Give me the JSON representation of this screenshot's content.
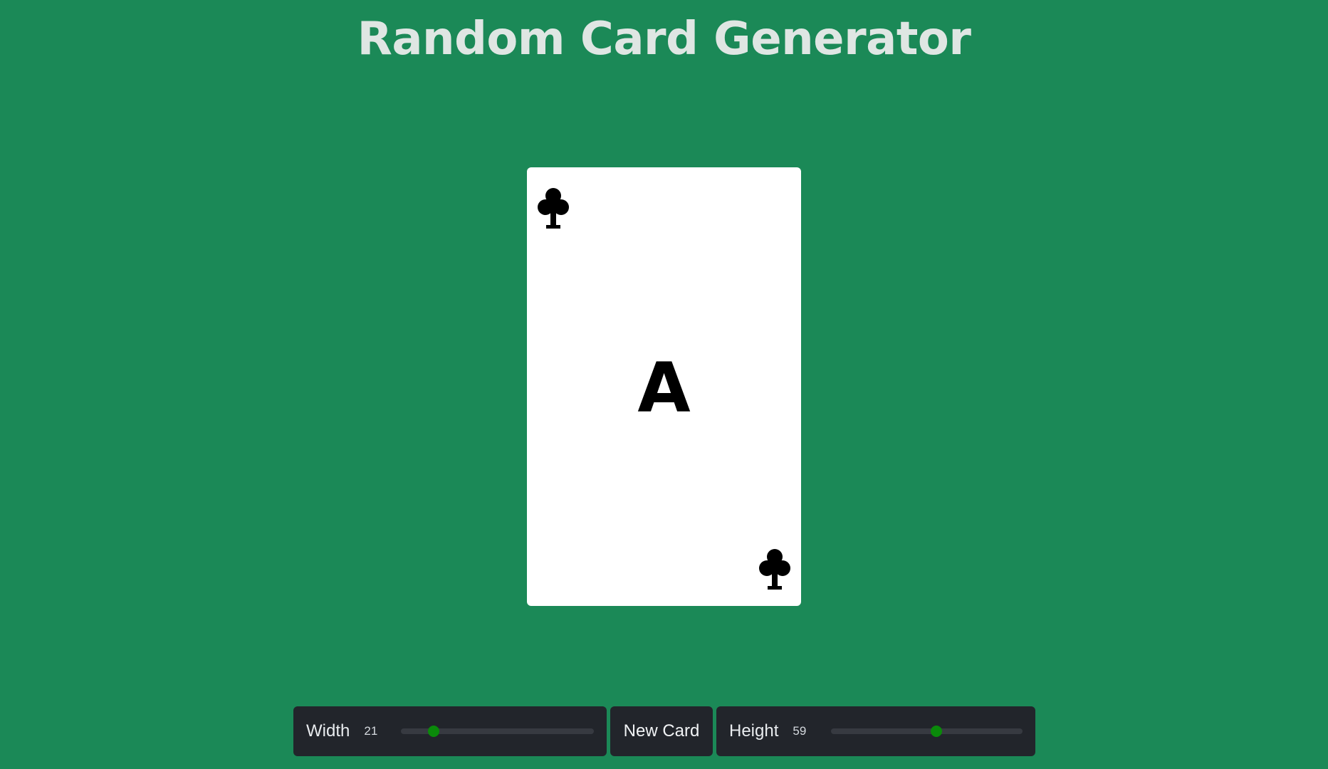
{
  "header": {
    "title": "Random Card Generator"
  },
  "card": {
    "rank": "A",
    "suit": "clubs",
    "suit_icon": "club-icon",
    "color": "#000000"
  },
  "controls": {
    "width": {
      "label": "Width",
      "value": "21",
      "level": 0.17
    },
    "new_card_label": "New Card",
    "height": {
      "label": "Height",
      "value": "59",
      "level": 0.55
    }
  },
  "colors": {
    "background": "#1b8957",
    "panel": "#22252b",
    "accent": "#0a8a0a"
  }
}
